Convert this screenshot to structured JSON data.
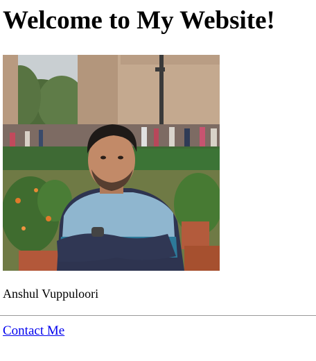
{
  "page": {
    "heading": "Welcome to My Website!",
    "name": "Anshul Vuppuloori",
    "contact_link": "Contact Me"
  },
  "photo": {
    "alt": "Photo of Anshul Vuppuloori"
  }
}
